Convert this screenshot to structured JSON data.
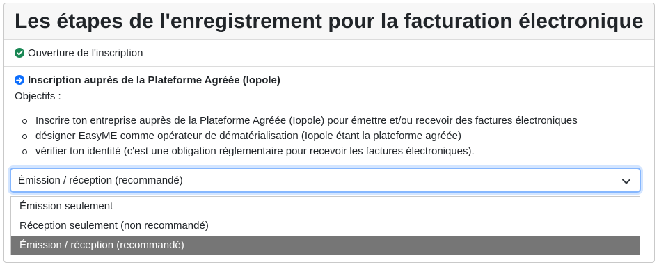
{
  "header": {
    "title": "Les étapes de l'enregistrement pour la facturation électronique"
  },
  "steps": {
    "done": {
      "label": "Ouverture de l'inscription",
      "icon": "check-circle-icon",
      "color": "#198754"
    },
    "current": {
      "title": "Inscription auprès de la Plateforme Agréée (Iopole)",
      "icon": "arrow-right-circle-icon",
      "color": "#0d6efd",
      "objectives_label": "Objectifs :",
      "objectives": [
        "Inscrire ton entreprise auprès de la Plateforme Agréée (Iopole) pour émettre et/ou recevoir des factures électroniques",
        "désigner EasyME comme opérateur de dématérialisation (Iopole étant la plateforme agréée)",
        "vérifier ton identité (c'est une obligation règlementaire pour recevoir les factures électroniques)."
      ]
    }
  },
  "mode_select": {
    "value": "Émission / réception (recommandé)",
    "options": [
      "Émission seulement",
      "Réception seulement (non recommandé)",
      "Émission / réception (recommandé)"
    ],
    "selected_index": 2
  }
}
